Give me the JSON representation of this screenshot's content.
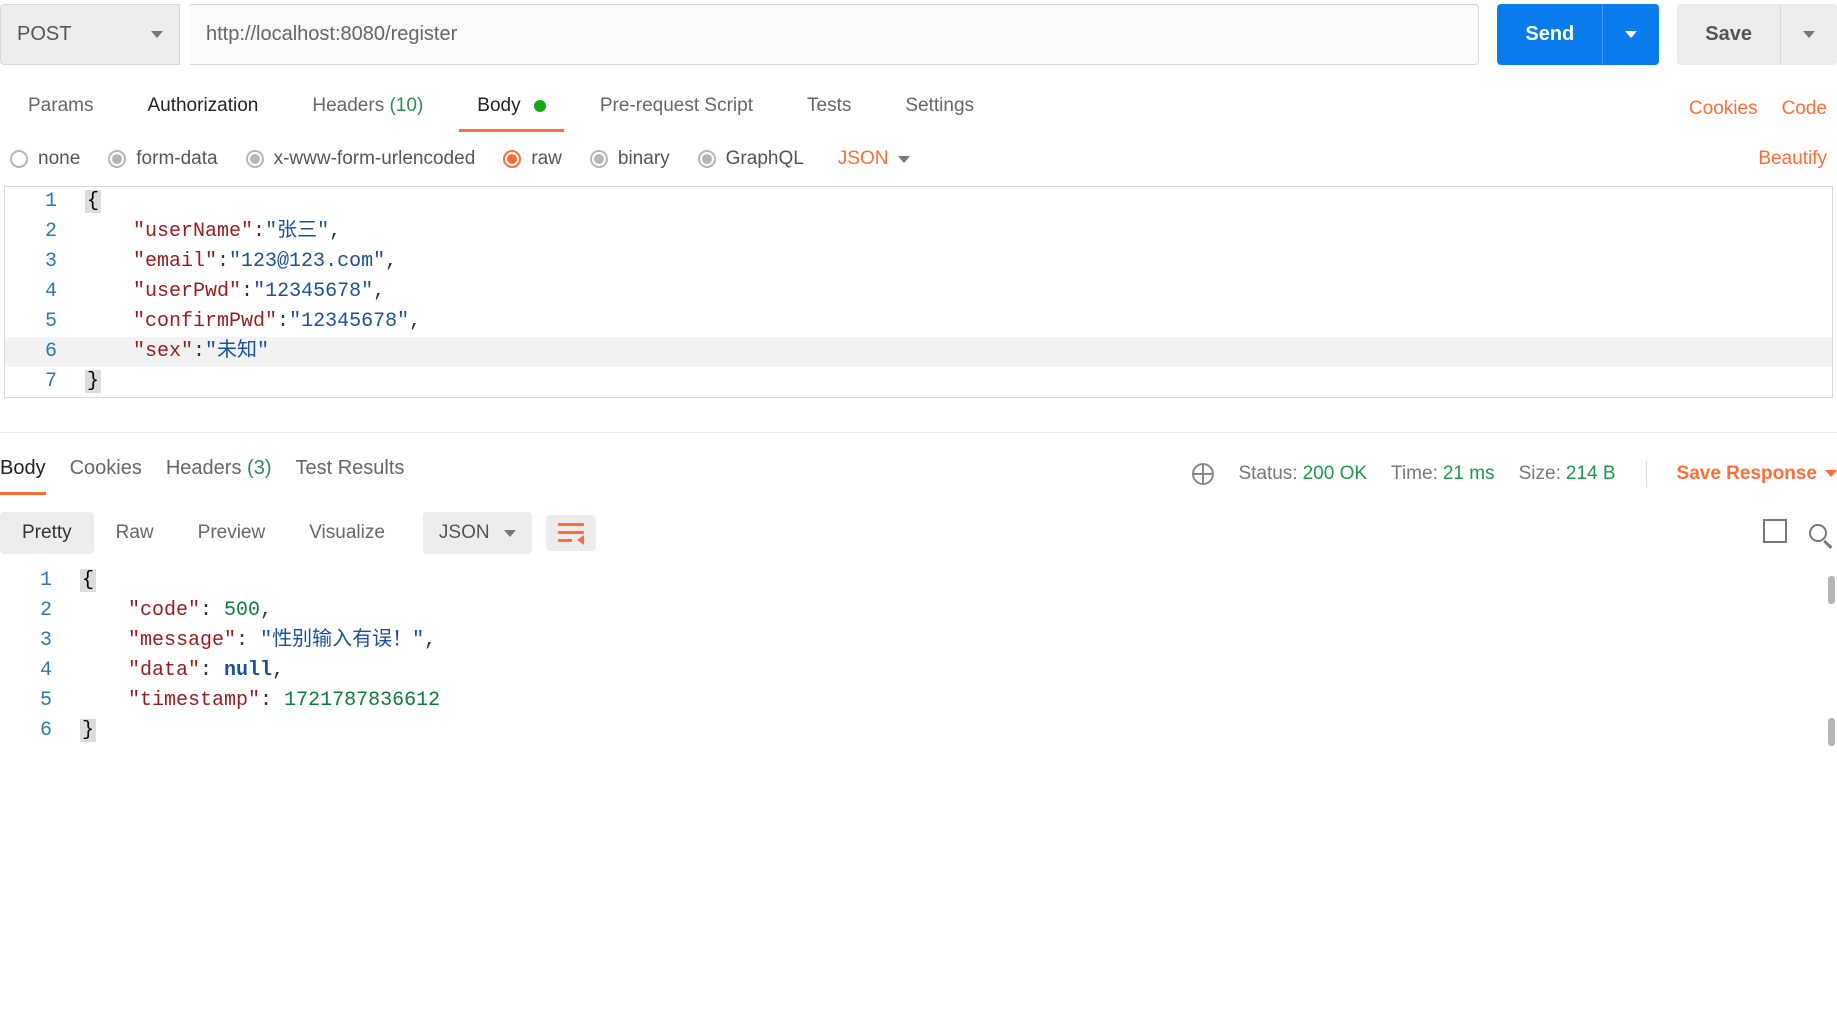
{
  "request": {
    "method": "POST",
    "url": "http://localhost:8080/register",
    "send_label": "Send",
    "save_label": "Save"
  },
  "tabs": {
    "params": "Params",
    "authorization": "Authorization",
    "headers_label": "Headers",
    "headers_count": "(10)",
    "body": "Body",
    "prerequest": "Pre-request Script",
    "tests": "Tests",
    "settings": "Settings",
    "cookies_link": "Cookies",
    "code_link": "Code"
  },
  "body_types": {
    "none": "none",
    "form_data": "form-data",
    "urlencoded": "x-www-form-urlencoded",
    "raw": "raw",
    "binary": "binary",
    "graphql": "GraphQL",
    "format": "JSON",
    "beautify": "Beautify"
  },
  "request_body": {
    "lines": [
      "1",
      "2",
      "3",
      "4",
      "5",
      "6",
      "7"
    ],
    "open_brace": "{",
    "close_brace": "}",
    "k_userName": "\"userName\"",
    "v_userName": "\"张三\"",
    "k_email": "\"email\"",
    "v_email": "\"123@123.com\"",
    "k_userPwd": "\"userPwd\"",
    "v_userPwd": "\"12345678\"",
    "k_confirmPwd": "\"confirmPwd\"",
    "v_confirmPwd": "\"12345678\"",
    "k_sex": "\"sex\"",
    "v_sex": "\"未知\""
  },
  "response_tabs": {
    "body": "Body",
    "cookies": "Cookies",
    "headers_label": "Headers",
    "headers_count": "(3)",
    "test_results": "Test Results"
  },
  "response_meta": {
    "status_label": "Status:",
    "status_value": "200 OK",
    "time_label": "Time:",
    "time_value": "21 ms",
    "size_label": "Size:",
    "size_value": "214 B",
    "save_response": "Save Response"
  },
  "view_modes": {
    "pretty": "Pretty",
    "raw": "Raw",
    "preview": "Preview",
    "visualize": "Visualize",
    "format": "JSON"
  },
  "response_body": {
    "lines": [
      "1",
      "2",
      "3",
      "4",
      "5",
      "6"
    ],
    "open_brace": "{",
    "close_brace": "}",
    "k_code": "\"code\"",
    "v_code": "500",
    "k_message": "\"message\"",
    "v_message": "\"性别输入有误！\"",
    "k_data": "\"data\"",
    "v_data": "null",
    "k_timestamp": "\"timestamp\"",
    "v_timestamp": "1721787836612"
  }
}
